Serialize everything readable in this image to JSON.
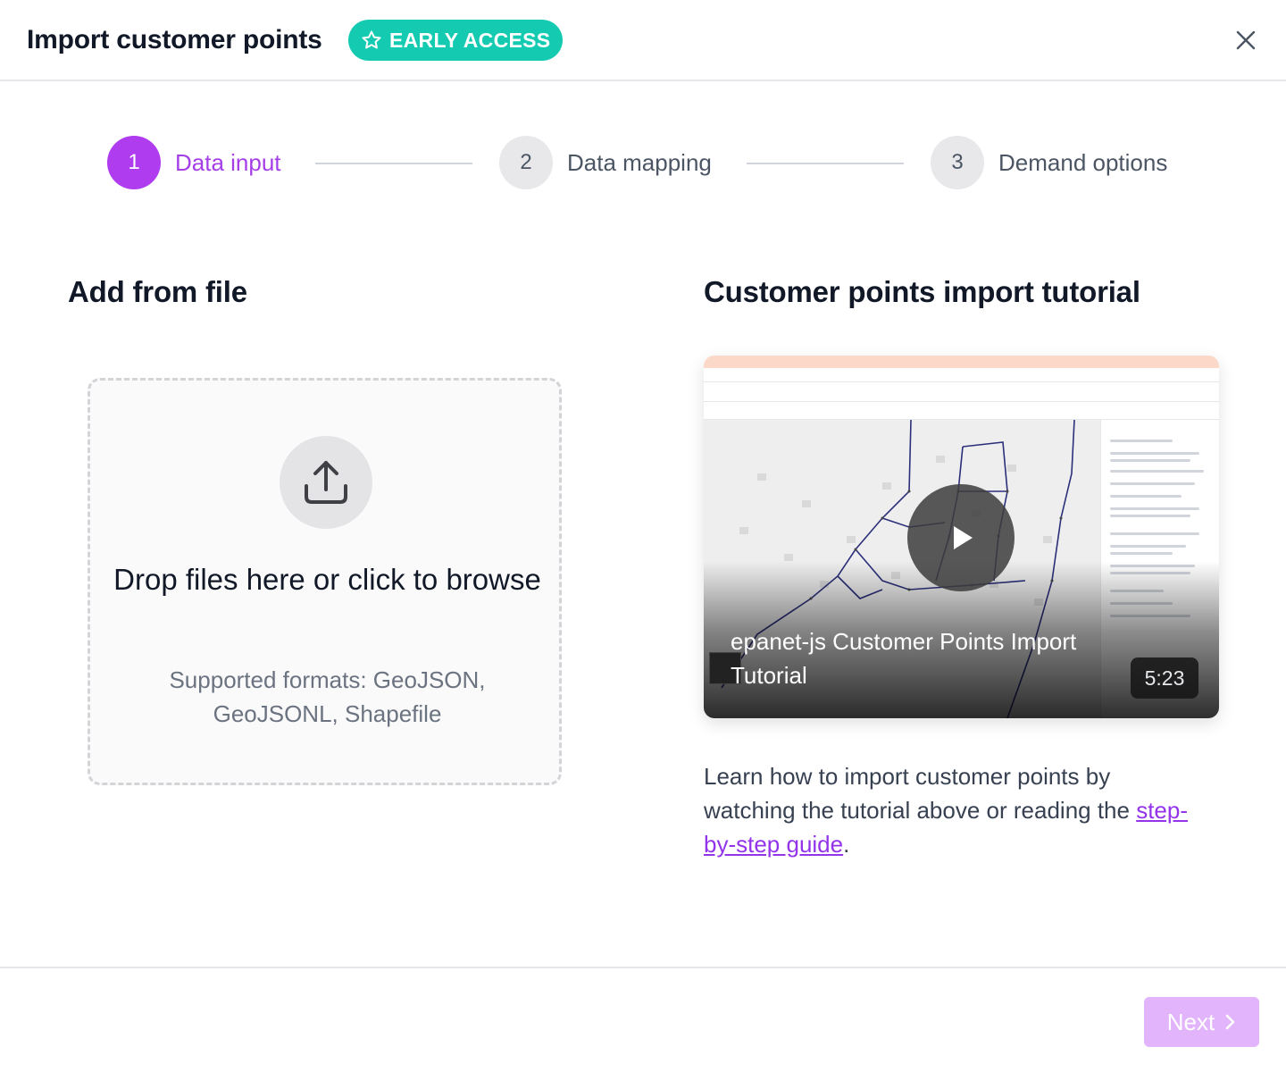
{
  "dialog": {
    "title": "Import customer points",
    "badge": "EARLY ACCESS"
  },
  "steps": [
    {
      "number": "1",
      "label": "Data input",
      "state": "active"
    },
    {
      "number": "2",
      "label": "Data mapping",
      "state": "inactive"
    },
    {
      "number": "3",
      "label": "Demand options",
      "state": "inactive"
    }
  ],
  "upload": {
    "heading": "Add from file",
    "drop_text": "Drop files here or click to browse",
    "formats": "Supported formats: GeoJSON, GeoJSONL, Shapefile"
  },
  "tutorial": {
    "heading": "Customer points import tutorial",
    "video_title": "epanet-js Customer Points Import Tutorial",
    "duration": "5:23",
    "desc_before": "Learn how to import customer points by watching the tutorial above or reading the ",
    "link_text": "step-by-step guide",
    "desc_after": "."
  },
  "footer": {
    "next_label": "Next"
  },
  "colors": {
    "accent": "#b03cf0",
    "badge": "#14cbb1",
    "next_disabled": "#e2b4fb"
  },
  "icons": [
    "star-icon",
    "close-icon",
    "upload-icon",
    "play-icon",
    "chevron-right-icon"
  ]
}
